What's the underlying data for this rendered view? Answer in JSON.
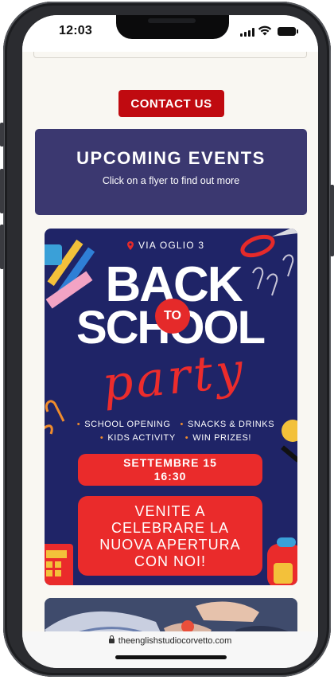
{
  "status_bar": {
    "time": "12:03"
  },
  "header": {
    "contact_label": "CONTACT US"
  },
  "events": {
    "title": "UPCOMING EVENTS",
    "subtitle": "Click on a flyer to find out more"
  },
  "flyer": {
    "location": "VIA OGLIO 3",
    "title_line1": "BACK",
    "title_connector": "TO",
    "title_line2": "SCHOOL",
    "title_script": "party",
    "bullets_row1": [
      "SCHOOL OPENING",
      "SNACKS & DRINKS"
    ],
    "bullets_row2": [
      "KIDS ACTIVITY",
      "WIN PRIZES!"
    ],
    "date": "SETTEMBRE 15",
    "time": "16:30",
    "cta_lines": [
      "VENITE A",
      "CELEBRARE LA",
      "NUOVA APERTURA",
      "CON NOI!"
    ],
    "colors": {
      "background": "#1f2467",
      "accent": "#ea2b2b",
      "bullet": "#f08c2c"
    }
  },
  "browser": {
    "url": "theenglishstudiocorvetto.com"
  },
  "icons": [
    "signal-icon",
    "wifi-icon",
    "battery-icon",
    "location-pin-icon",
    "lock-icon"
  ]
}
